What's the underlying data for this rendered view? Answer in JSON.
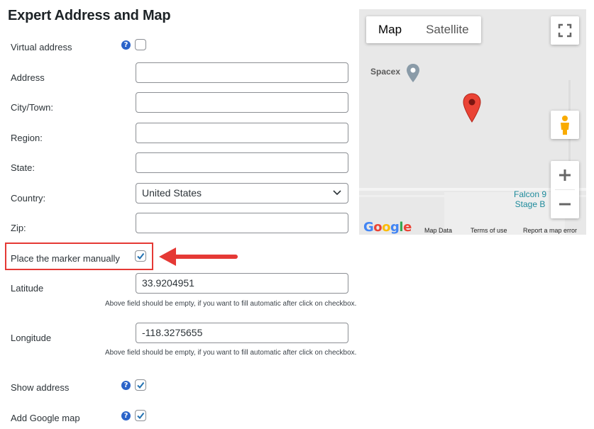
{
  "page": {
    "title": "Expert Address and Map"
  },
  "fields": {
    "virtual_address_label": "Virtual address",
    "address_label": "Address",
    "address_value": "",
    "city_label": "City/Town:",
    "city_value": "",
    "region_label": "Region:",
    "region_value": "",
    "state_label": "State:",
    "state_value": "",
    "country_label": "Country:",
    "country_value": "United States",
    "zip_label": "Zip:",
    "zip_value": "",
    "place_marker_label": "Place the marker manually",
    "latitude_label": "Latitude",
    "latitude_value": "33.9204951",
    "longitude_label": "Longitude",
    "longitude_value": "-118.3275655",
    "empty_hint": "Above field should be empty, if you want to fill automatic after click on checkbox.",
    "show_address_label": "Show address",
    "add_google_map_label": "Add Google map"
  },
  "checkboxes": {
    "virtual_address": false,
    "place_marker": true,
    "show_address": true,
    "add_google_map": true
  },
  "help_icon_glyph": "?",
  "map": {
    "tab_map": "Map",
    "tab_satellite": "Satellite",
    "poi_label": "Spacex",
    "falcon_line1": "Falcon 9",
    "falcon_line2": "Stage B",
    "google_logo": "Google",
    "footer_map_data": "Map Data",
    "footer_terms": "Terms of use",
    "footer_report": "Report a map error"
  },
  "colors": {
    "accent_blue": "#2271b1",
    "help_blue": "#2a63c9",
    "highlight_red": "#e53935",
    "marker_red": "#ea4335"
  }
}
